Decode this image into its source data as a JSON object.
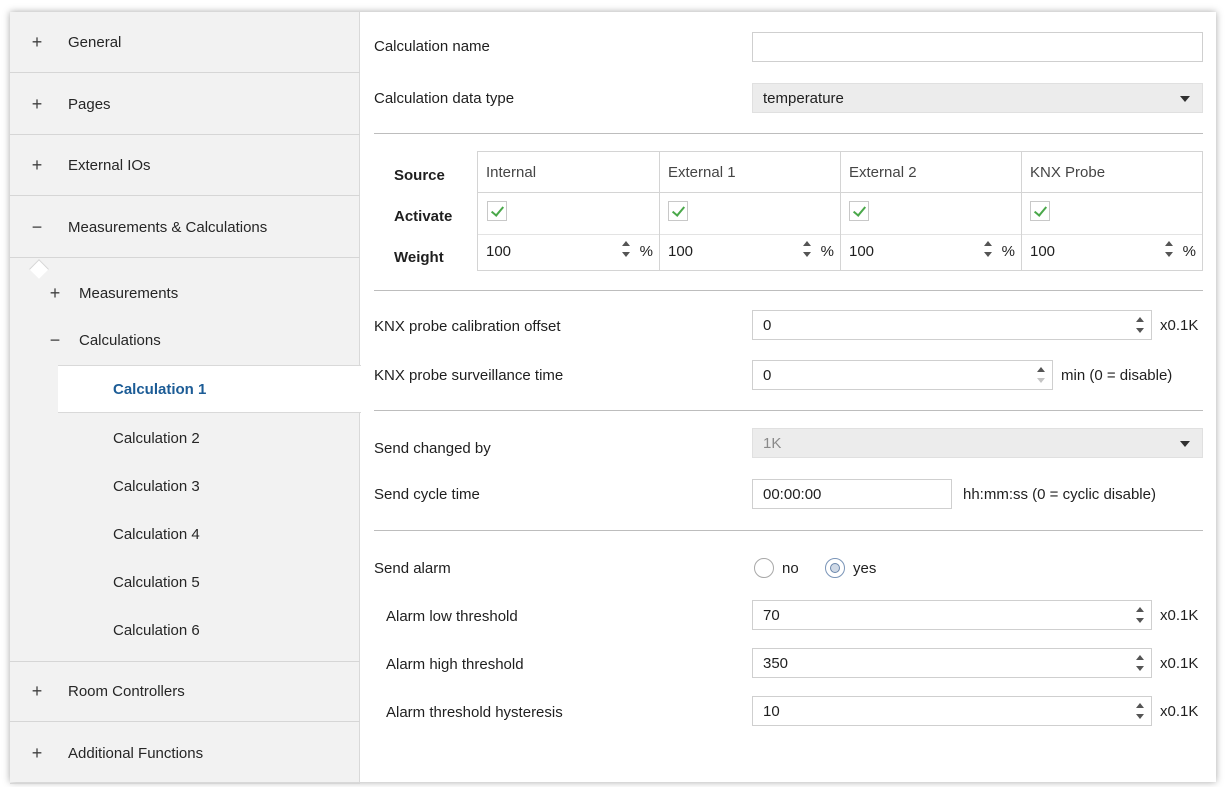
{
  "sidebar": {
    "top_items": [
      {
        "sign": "+",
        "label": "General"
      },
      {
        "sign": "+",
        "label": "Pages"
      },
      {
        "sign": "+",
        "label": "External IOs"
      },
      {
        "sign": "−",
        "label": "Measurements & Calculations"
      }
    ],
    "sub_items": [
      {
        "sign": "+",
        "label": "Measurements"
      },
      {
        "sign": "−",
        "label": "Calculations"
      }
    ],
    "calculations": [
      "Calculation 1",
      "Calculation 2",
      "Calculation 3",
      "Calculation 4",
      "Calculation 5",
      "Calculation 6"
    ],
    "bottom_items": [
      {
        "sign": "+",
        "label": "Room Controllers"
      },
      {
        "sign": "+",
        "label": "Additional Functions"
      }
    ]
  },
  "main": {
    "calc_name": {
      "label": "Calculation name",
      "value": ""
    },
    "calc_type": {
      "label": "Calculation data type",
      "value": "temperature"
    },
    "sources": {
      "row_labels": {
        "source": "Source",
        "activate": "Activate",
        "weight": "Weight"
      },
      "columns": [
        {
          "name": "Internal",
          "weight": "100",
          "unit": "%"
        },
        {
          "name": "External 1",
          "weight": "100",
          "unit": "%"
        },
        {
          "name": "External 2",
          "weight": "100",
          "unit": "%"
        },
        {
          "name": "KNX Probe",
          "weight": "100",
          "unit": "%"
        }
      ]
    },
    "calib_offset": {
      "label": "KNX probe calibration offset",
      "value": "0",
      "unit": "x0.1K"
    },
    "surv_time": {
      "label": "KNX probe surveillance time",
      "value": "0",
      "unit": "min (0 = disable)"
    },
    "send_changed": {
      "label": "Send changed by",
      "value": "1K"
    },
    "send_cycle": {
      "label": "Send cycle time",
      "value": "00:00:00",
      "unit": "hh:mm:ss (0 = cyclic disable)"
    },
    "send_alarm": {
      "label": "Send alarm",
      "no": "no",
      "yes": "yes",
      "selected": "yes"
    },
    "alarm_low": {
      "label": "Alarm low threshold",
      "value": "70",
      "unit": "x0.1K"
    },
    "alarm_high": {
      "label": "Alarm high threshold",
      "value": "350",
      "unit": "x0.1K"
    },
    "alarm_hyst": {
      "label": "Alarm threshold hysteresis",
      "value": "10",
      "unit": "x0.1K"
    }
  },
  "colors": {
    "active_nav": "#1c5c96",
    "check": "#4aa84a",
    "sidebar_bg": "#f2f2f2"
  }
}
